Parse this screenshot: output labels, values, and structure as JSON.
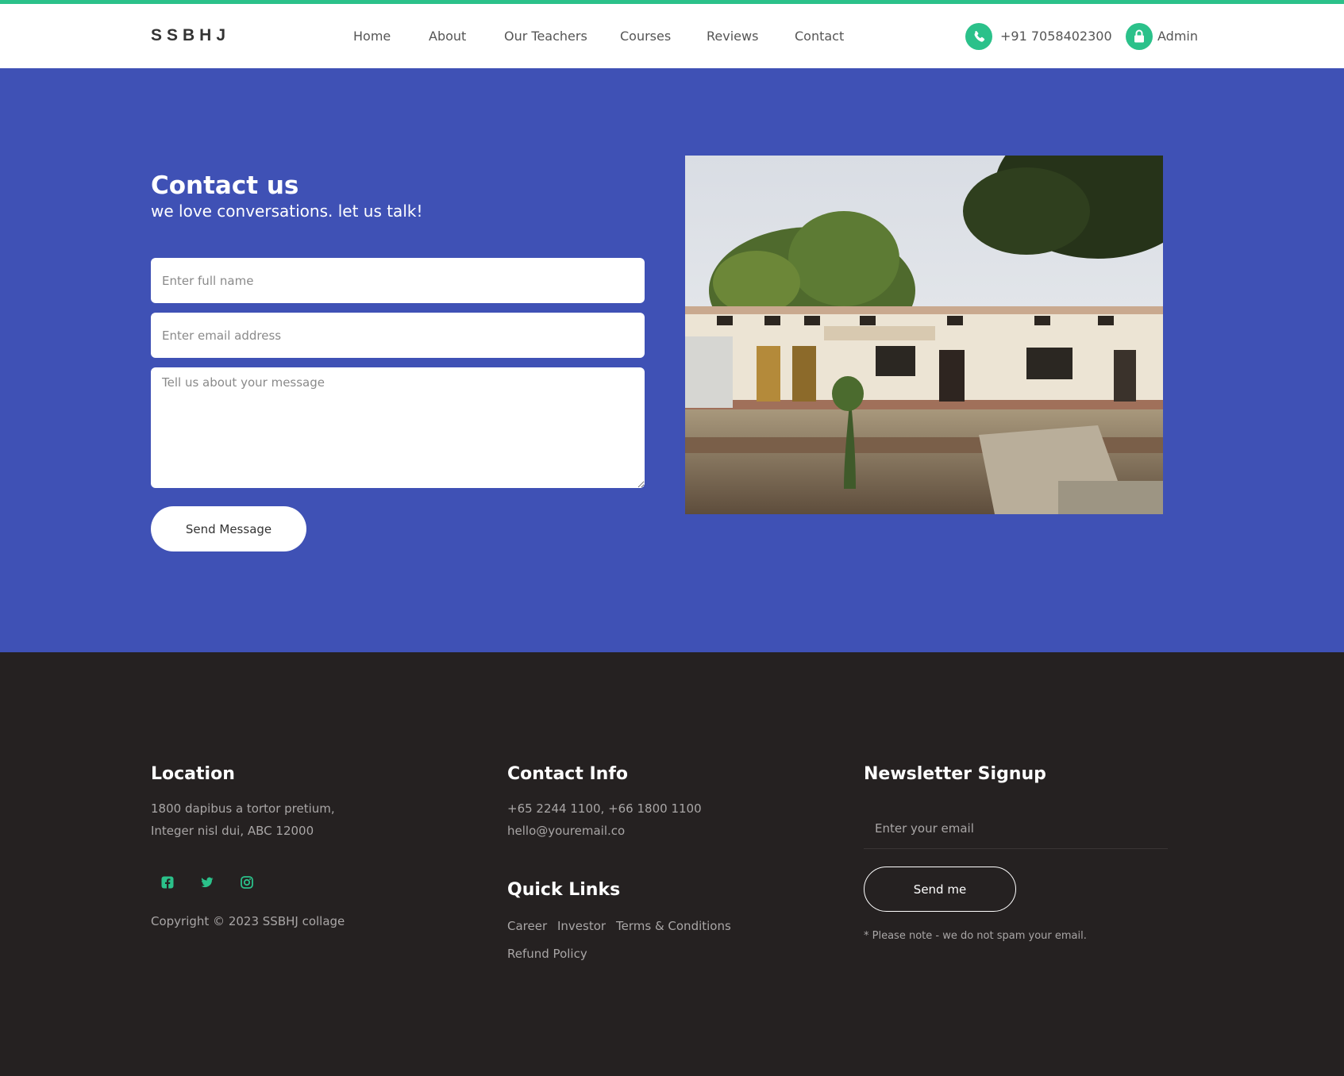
{
  "colors": {
    "accent": "#2bc18a",
    "hero_bg": "#3f51b5",
    "footer_bg": "#252121"
  },
  "header": {
    "brand": "SSBHJ",
    "nav": [
      {
        "label": "Home"
      },
      {
        "label": "About"
      },
      {
        "label": "Our Teachers"
      },
      {
        "label": "Courses"
      },
      {
        "label": "Reviews"
      },
      {
        "label": "Contact"
      }
    ],
    "phone": "+91 7058402300",
    "phone_icon": "phone-icon",
    "admin": "Admin",
    "admin_icon": "lock-icon"
  },
  "contact": {
    "title": "Contact us",
    "subtitle": "we love conversations. let us talk!",
    "name_placeholder": "Enter full name",
    "email_placeholder": "Enter email address",
    "message_placeholder": "Tell us about your message",
    "send_label": "Send Message"
  },
  "footer": {
    "location": {
      "heading": "Location",
      "line1": "1800 dapibus a tortor pretium,",
      "line2": "Integer nisl dui, ABC 12000"
    },
    "social": [
      "facebook-icon",
      "twitter-icon",
      "instagram-icon"
    ],
    "copyright": "Copyright © 2023 SSBHJ collage",
    "contact_info": {
      "heading": "Contact Info",
      "phones": "+65 2244 1100, +66 1800 1100",
      "email": "hello@youremail.co"
    },
    "quick_links": {
      "heading": "Quick Links",
      "items": [
        "Career",
        "Investor",
        "Terms & Conditions",
        "Refund Policy"
      ]
    },
    "newsletter": {
      "heading": "Newsletter Signup",
      "placeholder": "Enter your email",
      "button": "Send me",
      "note": "* Please note - we do not spam your email."
    }
  }
}
